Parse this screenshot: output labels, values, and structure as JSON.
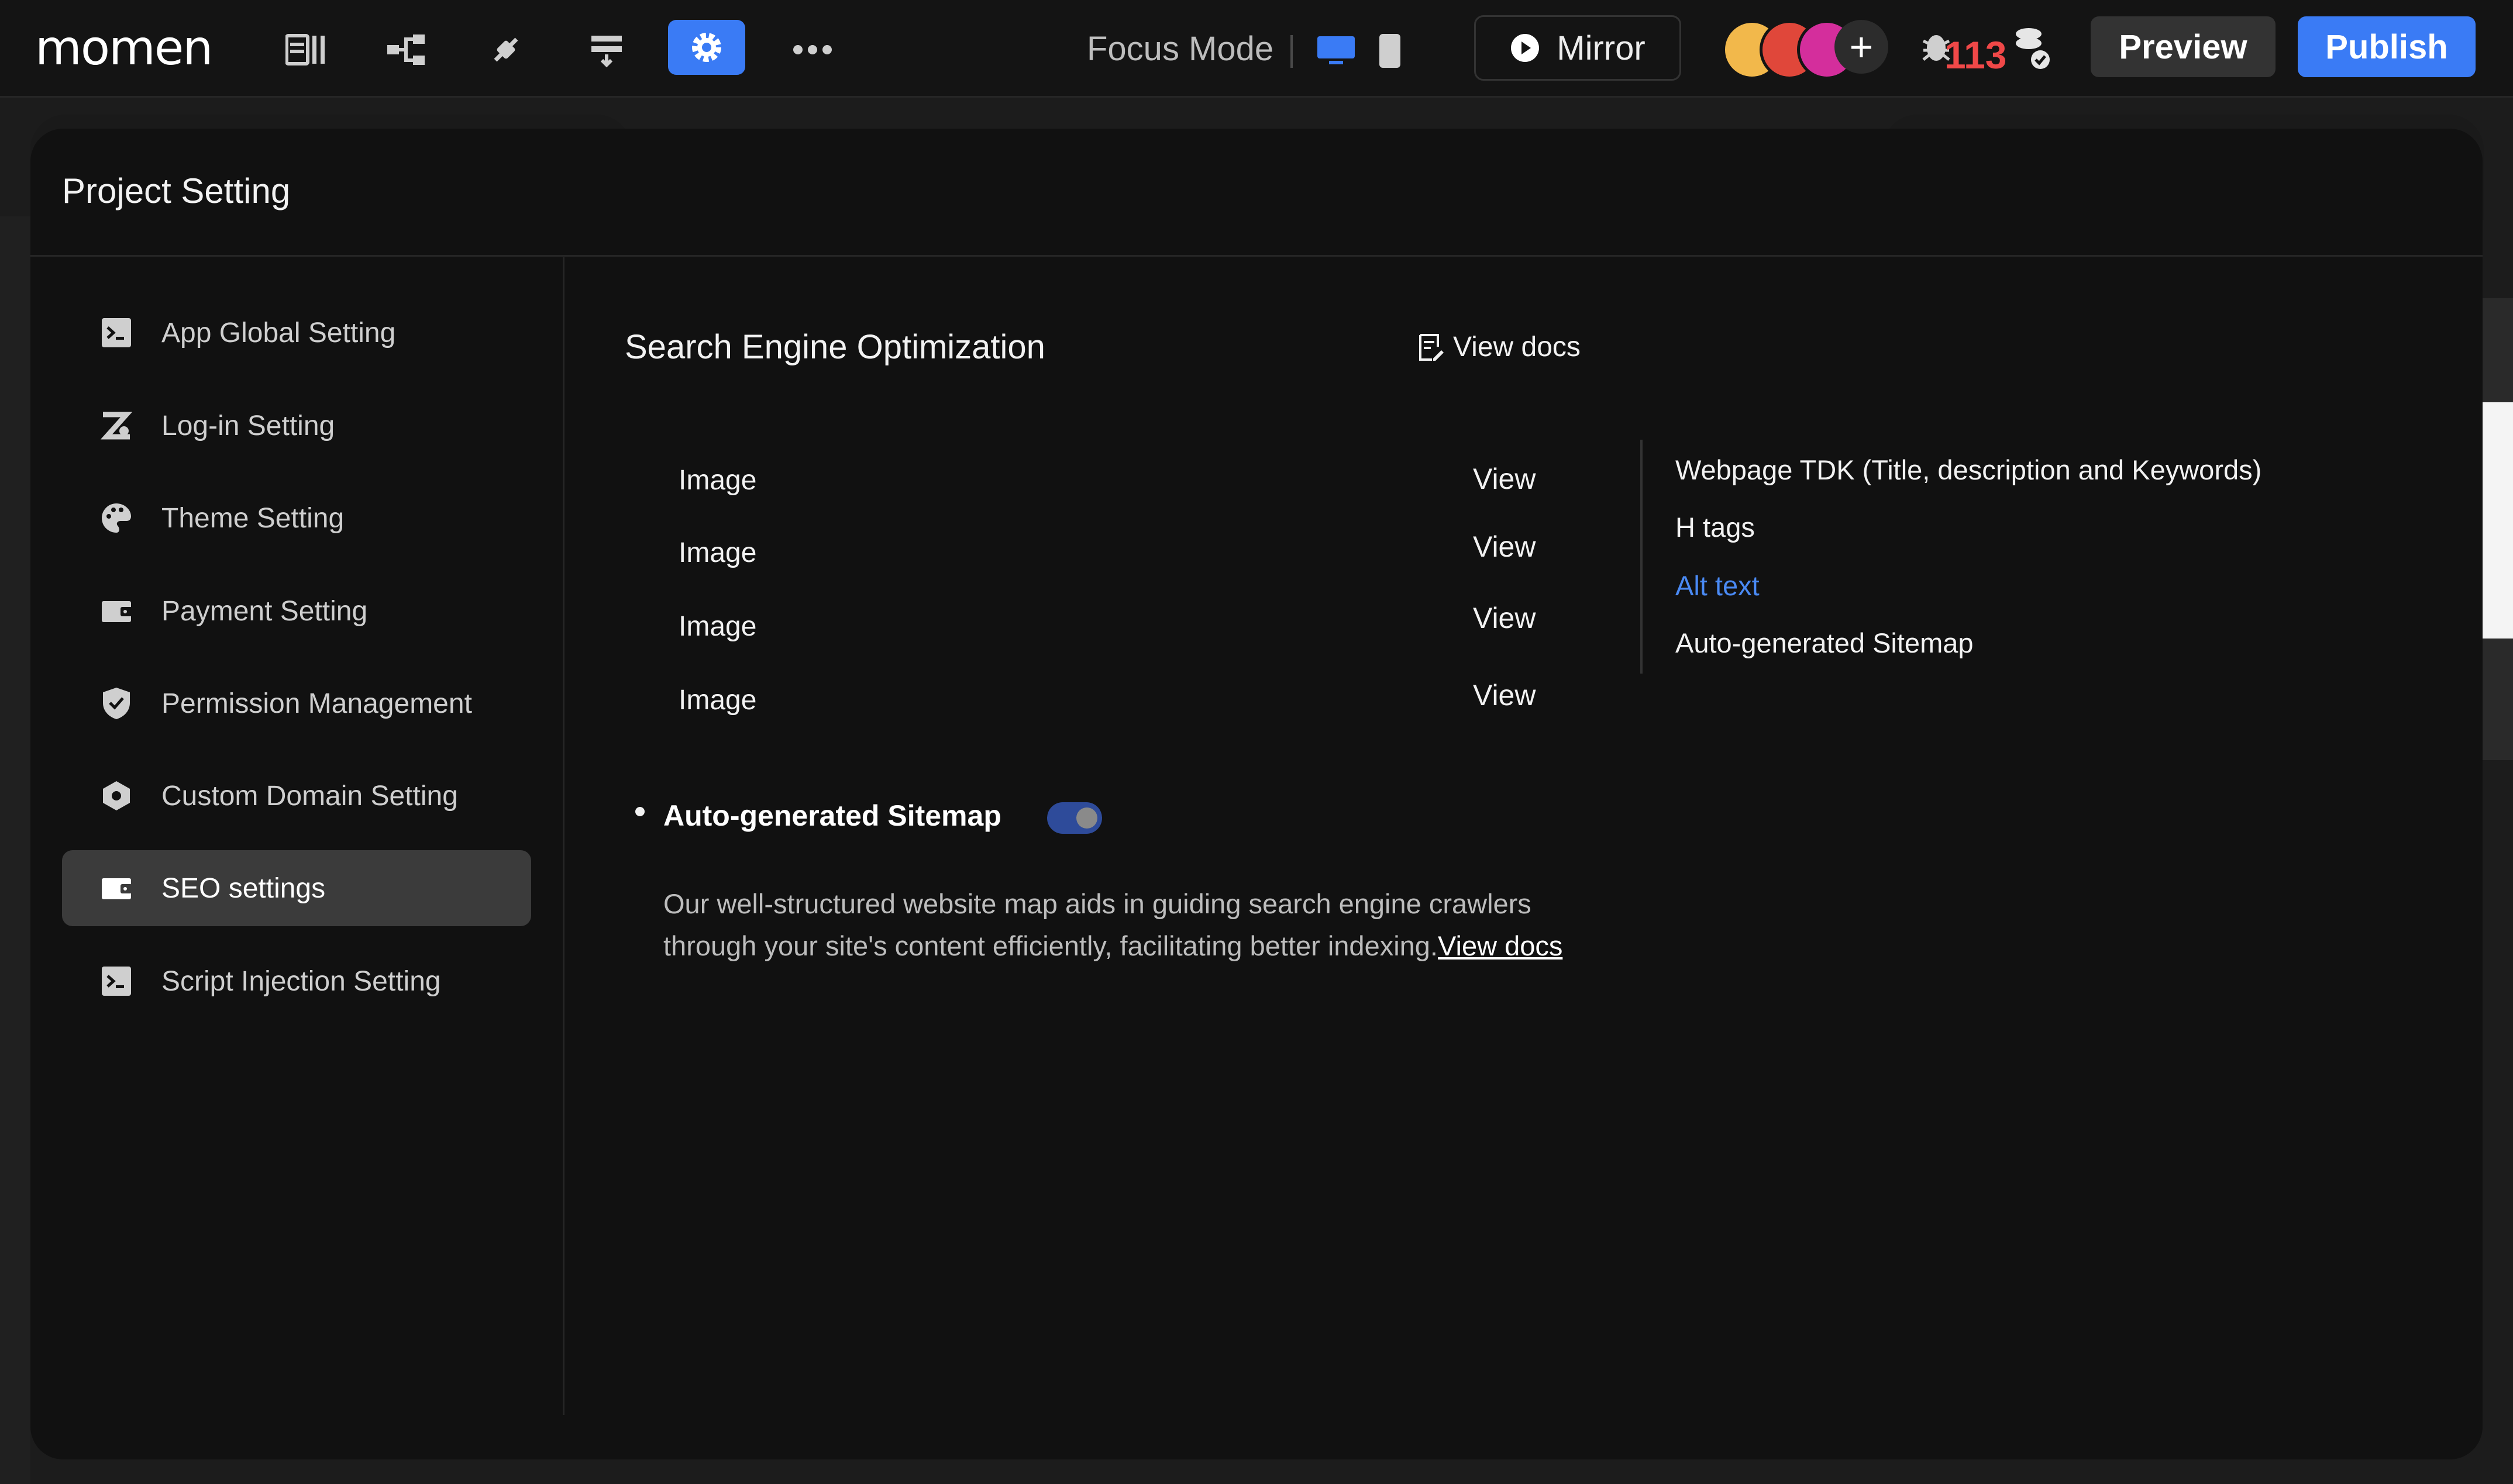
{
  "topbar": {
    "logo": "momen",
    "focus_mode": "Focus Mode",
    "mirror": "Mirror",
    "bug_count": "113",
    "preview": "Preview",
    "publish": "Publish",
    "icons": [
      "pages-icon",
      "tree-icon",
      "plugin-icon",
      "data-icon",
      "settings-icon",
      "more-icon"
    ]
  },
  "modal": {
    "title": "Project Setting",
    "sidebar": [
      {
        "label": "App Global Setting",
        "icon": "terminal-icon"
      },
      {
        "label": "Log-in Setting",
        "icon": "login-icon"
      },
      {
        "label": "Theme Setting",
        "icon": "palette-icon"
      },
      {
        "label": "Payment Setting",
        "icon": "wallet-icon"
      },
      {
        "label": "Permission Management",
        "icon": "shield-icon"
      },
      {
        "label": "Custom Domain Setting",
        "icon": "domain-icon"
      },
      {
        "label": "SEO settings",
        "icon": "wallet-icon",
        "active": true
      },
      {
        "label": "Script Injection Setting",
        "icon": "terminal-icon"
      }
    ]
  },
  "seo": {
    "title": "Search Engine Optimization",
    "view_docs": "View docs",
    "rows": [
      {
        "image": "Image",
        "view": "View"
      },
      {
        "image": "Image",
        "view": "View"
      },
      {
        "image": "Image",
        "view": "View"
      },
      {
        "image": "Image",
        "view": "View"
      }
    ],
    "toc": [
      {
        "label": "Webpage TDK (Title, description and Keywords)"
      },
      {
        "label": "H tags"
      },
      {
        "label": "Alt text",
        "active": true
      },
      {
        "label": "Auto-generated Sitemap"
      }
    ],
    "feature_title": "Auto-generated Sitemap",
    "toggle_on": true,
    "desc_line1": "Our well-structured website map aids in guiding search engine crawlers",
    "desc_line2": "through your site's content efficiently, facilitating better indexing.",
    "desc_link": "View docs"
  },
  "colors": {
    "accent": "#3a7bf5",
    "active_link": "#4a8af4",
    "bug": "#f04848"
  }
}
